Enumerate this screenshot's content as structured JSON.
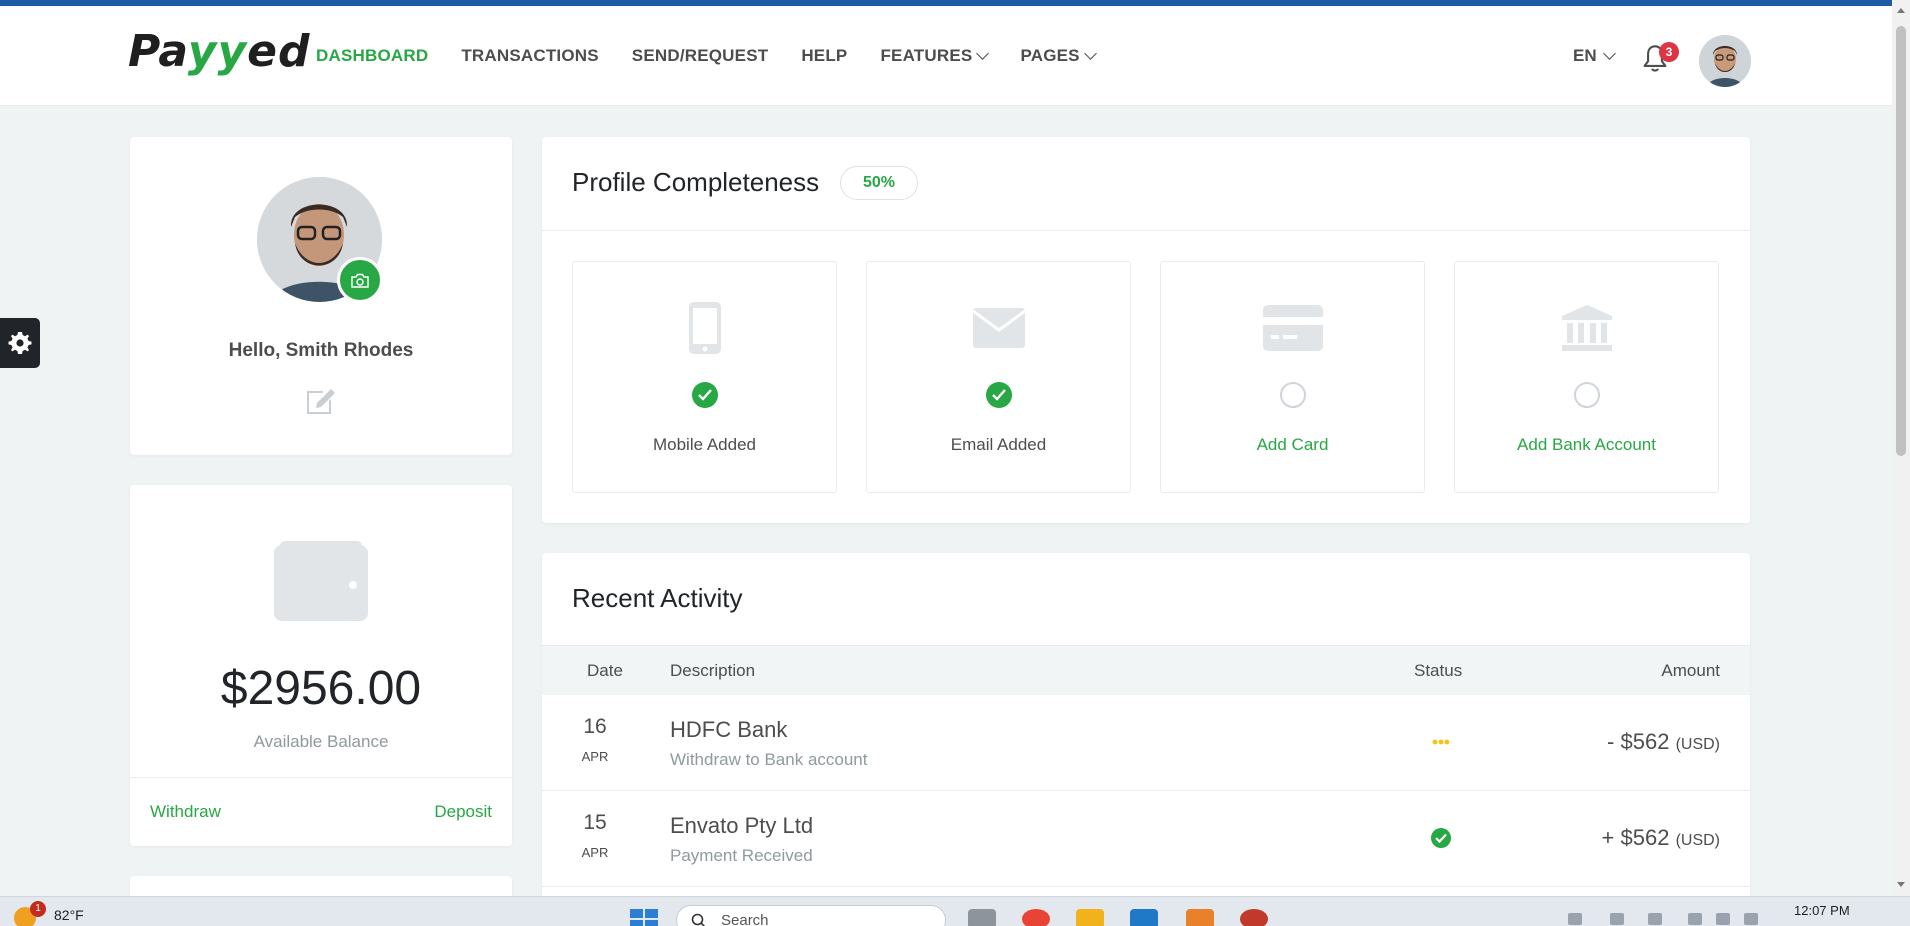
{
  "brand": {
    "logo_prefix": "Pa",
    "logo_highlight": "yy",
    "logo_suffix": "ed"
  },
  "nav": {
    "items": [
      {
        "label": "DASHBOARD",
        "active": true
      },
      {
        "label": "TRANSACTIONS"
      },
      {
        "label": "SEND/REQUEST"
      },
      {
        "label": "HELP"
      },
      {
        "label": "FEATURES",
        "has_dropdown": true
      },
      {
        "label": "PAGES",
        "has_dropdown": true
      }
    ],
    "language": "EN",
    "notifications_count": "3"
  },
  "profile": {
    "greeting": "Hello, Smith Rhodes"
  },
  "balance": {
    "amount": "$2956.00",
    "label": "Available Balance",
    "withdraw_label": "Withdraw",
    "deposit_label": "Deposit"
  },
  "completeness": {
    "title": "Profile Completeness",
    "percent": "50%",
    "steps": [
      {
        "label": "Mobile Added",
        "icon": "mobile-icon",
        "done": true
      },
      {
        "label": "Email Added",
        "icon": "envelope-icon",
        "done": true
      },
      {
        "label": "Add Card",
        "icon": "credit-card-icon",
        "done": false
      },
      {
        "label": "Add Bank Account",
        "icon": "bank-icon",
        "done": false
      }
    ]
  },
  "activity": {
    "title": "Recent Activity",
    "columns": [
      "Date",
      "Description",
      "Status",
      "Amount"
    ],
    "rows": [
      {
        "day": "16",
        "month": "APR",
        "name": "HDFC Bank",
        "sub": "Withdraw to Bank account",
        "status": "pending",
        "amount": "- $562",
        "currency": "(USD)"
      },
      {
        "day": "15",
        "month": "APR",
        "name": "Envato Pty Ltd",
        "sub": "Payment Received",
        "status": "completed",
        "amount": "+ $562",
        "currency": "(USD)"
      }
    ]
  },
  "taskbar": {
    "weather_temp": "82°F",
    "weather_badge": "1",
    "search_placeholder": "Search",
    "time": "12:07 PM"
  },
  "colors": {
    "accent": "#28a745",
    "topbar": "#1e5da6",
    "badge": "#dc3545",
    "pending": "#ffc107"
  }
}
